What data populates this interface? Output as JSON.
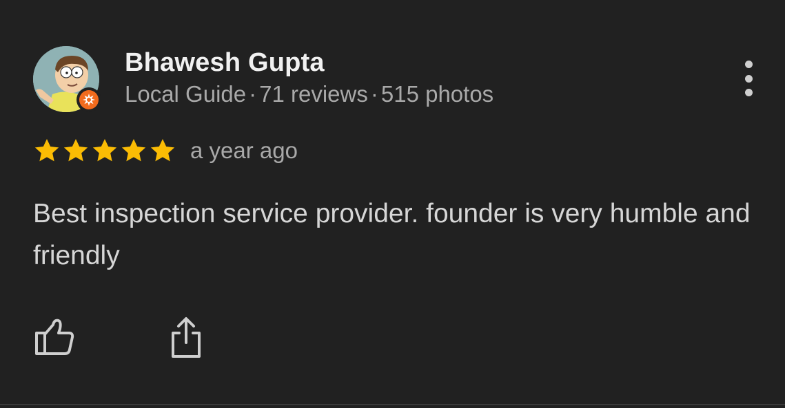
{
  "reviewer": {
    "name": "Bhawesh Gupta",
    "level": "Local Guide",
    "reviews": "71 reviews",
    "photos": "515 photos",
    "separator": "·",
    "avatar_icon": "cartoon-avatar",
    "badge_icon": "local-guide-badge-icon",
    "badge_color": "#f26b1d"
  },
  "review": {
    "rating": 5,
    "rating_max": 5,
    "star_color": "#fbbc04",
    "time": "a year ago",
    "text": "Best inspection service provider. founder is very humble and friendly"
  },
  "actions": {
    "more_icon": "more-vertical-icon",
    "like_icon": "thumbs-up-icon",
    "share_icon": "share-icon"
  }
}
